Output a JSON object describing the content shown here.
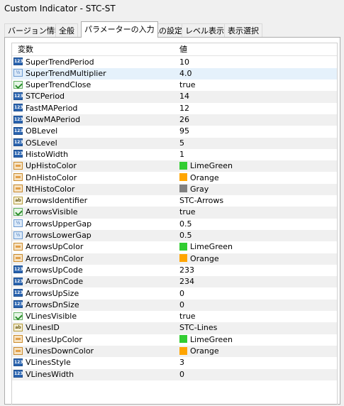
{
  "window": {
    "title": "Custom Indicator - STC-ST"
  },
  "tabs": [
    {
      "label": "バージョン情報"
    },
    {
      "label": "全般"
    },
    {
      "label": "パラメーターの入力"
    },
    {
      "label": "色の設定"
    },
    {
      "label": "レベル表示"
    },
    {
      "label": "表示選択"
    }
  ],
  "table": {
    "col_name": "変数",
    "col_value": "値",
    "rows": [
      {
        "icon": "int-icon",
        "name": "SuperTrendPeriod",
        "value": "10"
      },
      {
        "icon": "double-icon",
        "name": "SuperTrendMultiplier",
        "value": "4.0"
      },
      {
        "icon": "bool-icon",
        "name": "SuperTrendClose",
        "value": "true"
      },
      {
        "icon": "int-icon",
        "name": "STCPeriod",
        "value": "14"
      },
      {
        "icon": "int-icon",
        "name": "FastMAPeriod",
        "value": "12"
      },
      {
        "icon": "int-icon",
        "name": "SlowMAPeriod",
        "value": "26"
      },
      {
        "icon": "int-icon",
        "name": "OBLevel",
        "value": "95"
      },
      {
        "icon": "int-icon",
        "name": "OSLevel",
        "value": "5"
      },
      {
        "icon": "int-icon",
        "name": "HistoWidth",
        "value": "1"
      },
      {
        "icon": "color-icon",
        "name": "UpHistoColor",
        "value": "LimeGreen",
        "swatch": "#32cd32"
      },
      {
        "icon": "color-icon",
        "name": "DnHistoColor",
        "value": "Orange",
        "swatch": "#ffa500"
      },
      {
        "icon": "color-icon",
        "name": "NtHistoColor",
        "value": "Gray",
        "swatch": "#808080"
      },
      {
        "icon": "string-icon",
        "name": "ArrowsIdentifier",
        "value": "STC-Arrows"
      },
      {
        "icon": "bool-icon",
        "name": "ArrowsVisible",
        "value": "true"
      },
      {
        "icon": "double-icon",
        "name": "ArrowsUpperGap",
        "value": "0.5"
      },
      {
        "icon": "double-icon",
        "name": "ArrowsLowerGap",
        "value": "0.5"
      },
      {
        "icon": "color-icon",
        "name": "ArrowsUpColor",
        "value": "LimeGreen",
        "swatch": "#32cd32"
      },
      {
        "icon": "color-icon",
        "name": "ArrowsDnColor",
        "value": "Orange",
        "swatch": "#ffa500"
      },
      {
        "icon": "int-icon",
        "name": "ArrowsUpCode",
        "value": "233"
      },
      {
        "icon": "int-icon",
        "name": "ArrowsDnCode",
        "value": "234"
      },
      {
        "icon": "int-icon",
        "name": "ArrowsUpSize",
        "value": "0"
      },
      {
        "icon": "int-icon",
        "name": "ArrowsDnSize",
        "value": "0"
      },
      {
        "icon": "bool-icon",
        "name": "VLinesVisible",
        "value": "true"
      },
      {
        "icon": "string-icon",
        "name": "VLinesID",
        "value": "STC-Lines"
      },
      {
        "icon": "color-icon",
        "name": "VLinesUpColor",
        "value": "LimeGreen",
        "swatch": "#32cd32"
      },
      {
        "icon": "color-icon",
        "name": "VLinesDownColor",
        "value": "Orange",
        "swatch": "#ffa500"
      },
      {
        "icon": "int-icon",
        "name": "VLinesStyle",
        "value": "3"
      },
      {
        "icon": "int-icon",
        "name": "VLinesWidth",
        "value": "0"
      }
    ]
  }
}
